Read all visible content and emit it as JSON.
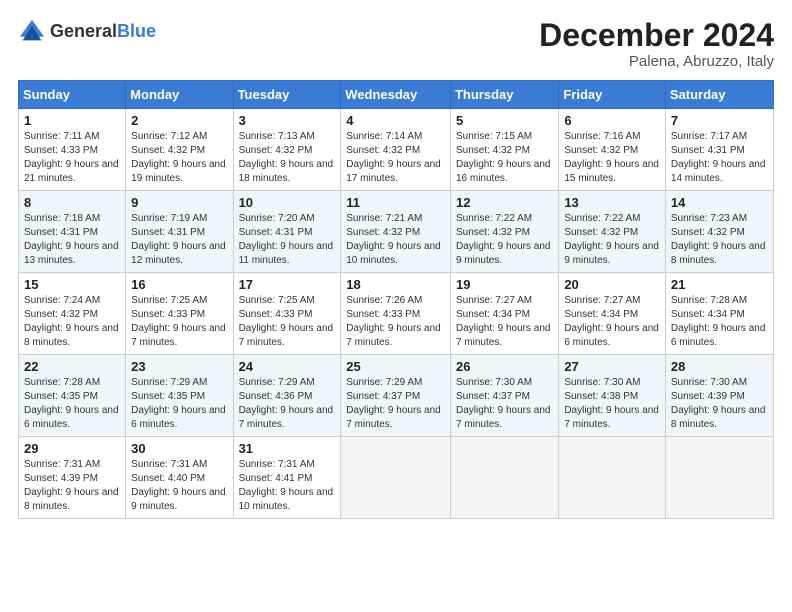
{
  "logo": {
    "general": "General",
    "blue": "Blue"
  },
  "title": "December 2024",
  "subtitle": "Palena, Abruzzo, Italy",
  "days_header": [
    "Sunday",
    "Monday",
    "Tuesday",
    "Wednesday",
    "Thursday",
    "Friday",
    "Saturday"
  ],
  "weeks": [
    [
      {
        "day": "1",
        "sunrise": "7:11 AM",
        "sunset": "4:33 PM",
        "daylight": "9 hours and 21 minutes."
      },
      {
        "day": "2",
        "sunrise": "7:12 AM",
        "sunset": "4:32 PM",
        "daylight": "9 hours and 19 minutes."
      },
      {
        "day": "3",
        "sunrise": "7:13 AM",
        "sunset": "4:32 PM",
        "daylight": "9 hours and 18 minutes."
      },
      {
        "day": "4",
        "sunrise": "7:14 AM",
        "sunset": "4:32 PM",
        "daylight": "9 hours and 17 minutes."
      },
      {
        "day": "5",
        "sunrise": "7:15 AM",
        "sunset": "4:32 PM",
        "daylight": "9 hours and 16 minutes."
      },
      {
        "day": "6",
        "sunrise": "7:16 AM",
        "sunset": "4:32 PM",
        "daylight": "9 hours and 15 minutes."
      },
      {
        "day": "7",
        "sunrise": "7:17 AM",
        "sunset": "4:31 PM",
        "daylight": "9 hours and 14 minutes."
      }
    ],
    [
      {
        "day": "8",
        "sunrise": "7:18 AM",
        "sunset": "4:31 PM",
        "daylight": "9 hours and 13 minutes."
      },
      {
        "day": "9",
        "sunrise": "7:19 AM",
        "sunset": "4:31 PM",
        "daylight": "9 hours and 12 minutes."
      },
      {
        "day": "10",
        "sunrise": "7:20 AM",
        "sunset": "4:31 PM",
        "daylight": "9 hours and 11 minutes."
      },
      {
        "day": "11",
        "sunrise": "7:21 AM",
        "sunset": "4:32 PM",
        "daylight": "9 hours and 10 minutes."
      },
      {
        "day": "12",
        "sunrise": "7:22 AM",
        "sunset": "4:32 PM",
        "daylight": "9 hours and 9 minutes."
      },
      {
        "day": "13",
        "sunrise": "7:22 AM",
        "sunset": "4:32 PM",
        "daylight": "9 hours and 9 minutes."
      },
      {
        "day": "14",
        "sunrise": "7:23 AM",
        "sunset": "4:32 PM",
        "daylight": "9 hours and 8 minutes."
      }
    ],
    [
      {
        "day": "15",
        "sunrise": "7:24 AM",
        "sunset": "4:32 PM",
        "daylight": "9 hours and 8 minutes."
      },
      {
        "day": "16",
        "sunrise": "7:25 AM",
        "sunset": "4:33 PM",
        "daylight": "9 hours and 7 minutes."
      },
      {
        "day": "17",
        "sunrise": "7:25 AM",
        "sunset": "4:33 PM",
        "daylight": "9 hours and 7 minutes."
      },
      {
        "day": "18",
        "sunrise": "7:26 AM",
        "sunset": "4:33 PM",
        "daylight": "9 hours and 7 minutes."
      },
      {
        "day": "19",
        "sunrise": "7:27 AM",
        "sunset": "4:34 PM",
        "daylight": "9 hours and 7 minutes."
      },
      {
        "day": "20",
        "sunrise": "7:27 AM",
        "sunset": "4:34 PM",
        "daylight": "9 hours and 6 minutes."
      },
      {
        "day": "21",
        "sunrise": "7:28 AM",
        "sunset": "4:34 PM",
        "daylight": "9 hours and 6 minutes."
      }
    ],
    [
      {
        "day": "22",
        "sunrise": "7:28 AM",
        "sunset": "4:35 PM",
        "daylight": "9 hours and 6 minutes."
      },
      {
        "day": "23",
        "sunrise": "7:29 AM",
        "sunset": "4:35 PM",
        "daylight": "9 hours and 6 minutes."
      },
      {
        "day": "24",
        "sunrise": "7:29 AM",
        "sunset": "4:36 PM",
        "daylight": "9 hours and 7 minutes."
      },
      {
        "day": "25",
        "sunrise": "7:29 AM",
        "sunset": "4:37 PM",
        "daylight": "9 hours and 7 minutes."
      },
      {
        "day": "26",
        "sunrise": "7:30 AM",
        "sunset": "4:37 PM",
        "daylight": "9 hours and 7 minutes."
      },
      {
        "day": "27",
        "sunrise": "7:30 AM",
        "sunset": "4:38 PM",
        "daylight": "9 hours and 7 minutes."
      },
      {
        "day": "28",
        "sunrise": "7:30 AM",
        "sunset": "4:39 PM",
        "daylight": "9 hours and 8 minutes."
      }
    ],
    [
      {
        "day": "29",
        "sunrise": "7:31 AM",
        "sunset": "4:39 PM",
        "daylight": "9 hours and 8 minutes."
      },
      {
        "day": "30",
        "sunrise": "7:31 AM",
        "sunset": "4:40 PM",
        "daylight": "9 hours and 9 minutes."
      },
      {
        "day": "31",
        "sunrise": "7:31 AM",
        "sunset": "4:41 PM",
        "daylight": "9 hours and 10 minutes."
      },
      null,
      null,
      null,
      null
    ]
  ]
}
